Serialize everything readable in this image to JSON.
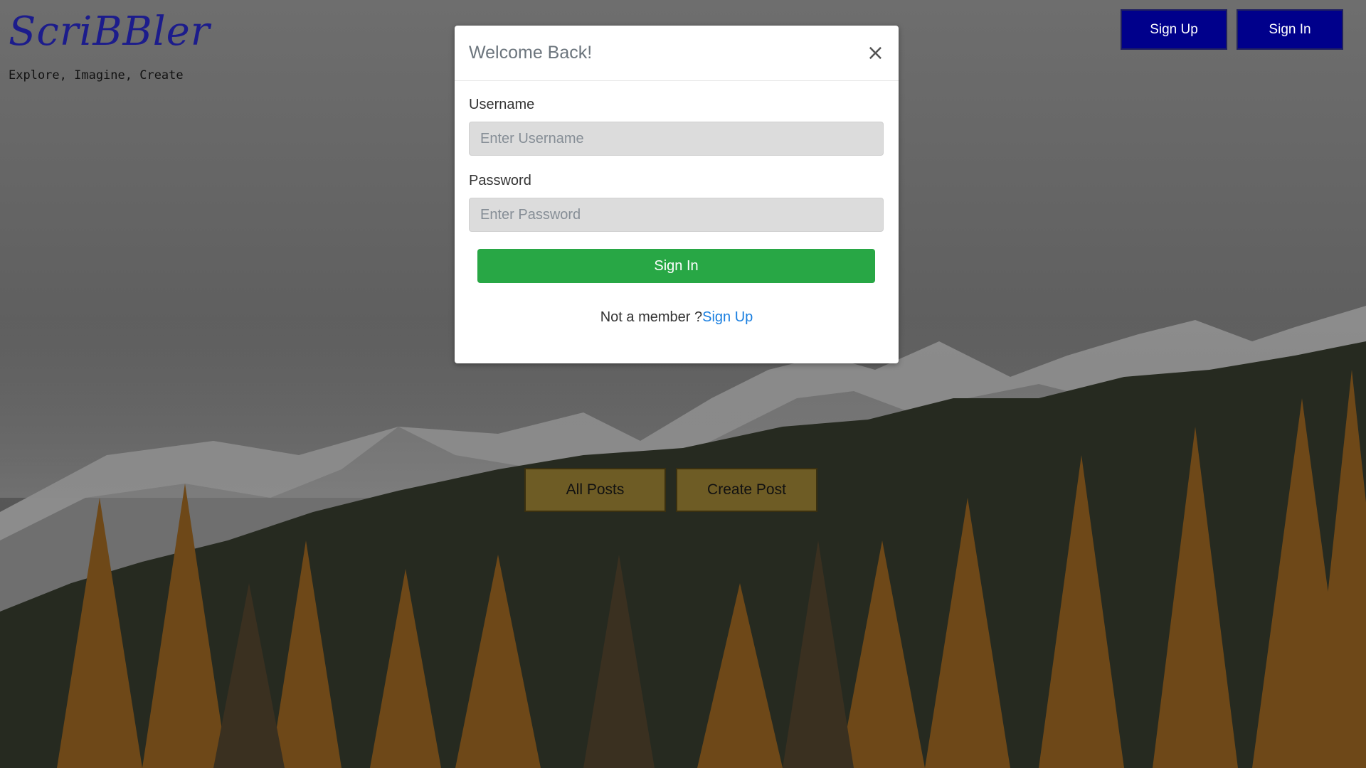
{
  "brand": {
    "logo": "ScriBBler",
    "tagline": "Explore, Imagine, Create"
  },
  "header": {
    "signup_label": "Sign Up",
    "signin_label": "Sign In"
  },
  "actions": {
    "all_posts_label": "All Posts",
    "create_post_label": "Create Post"
  },
  "modal": {
    "title": "Welcome Back!",
    "close_glyph": "×",
    "username_label": "Username",
    "username_placeholder": "Enter Username",
    "username_value": "",
    "password_label": "Password",
    "password_placeholder": "Enter Password",
    "password_value": "",
    "submit_label": "Sign In",
    "not_member_text": "Not a member ?",
    "signup_link_text": "Sign Up"
  },
  "colors": {
    "logo": "#1c1c8c",
    "header_button": "#00008b",
    "action_button": "#6e5c25",
    "submit_button": "#28a745",
    "link": "#1a7fe0"
  },
  "icons": {
    "close": "close-icon"
  }
}
